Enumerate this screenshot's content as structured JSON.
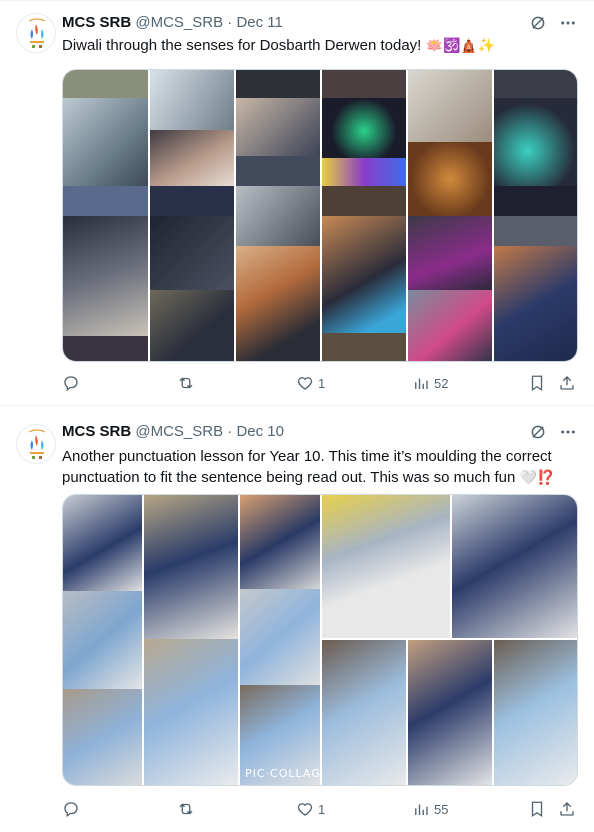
{
  "colors": {
    "text": "#0f1419",
    "secondary": "#536471",
    "divider": "#eff3f4",
    "media_border": "#cfd9de"
  },
  "tweets": [
    {
      "name": "MCS SRB",
      "handle": "@MCS_SRB",
      "dot": "·",
      "date": "Dec 11",
      "text": "Diwali through the senses for Dosbarth Derwen today!",
      "emojis": "🪷🕉️🛕✨",
      "media_alt": "Collage of students exploring Diwali sensory activities",
      "stats": {
        "replies": "",
        "reposts": "",
        "likes": "1",
        "views": "52"
      }
    },
    {
      "name": "MCS SRB",
      "handle": "@MCS_SRB",
      "dot": "·",
      "date": "Dec 10",
      "text": "Another punctuation lesson for Year 10. This time it’s moulding the correct punctuation to fit the sentence being read out. This was so much fun",
      "emojis": "🤍⁉️",
      "watermark": "PIC·COLLAGE",
      "media_alt": "Collage of students moulding punctuation marks",
      "stats": {
        "replies": "",
        "reposts": "",
        "likes": "1",
        "views": "55"
      }
    }
  ]
}
